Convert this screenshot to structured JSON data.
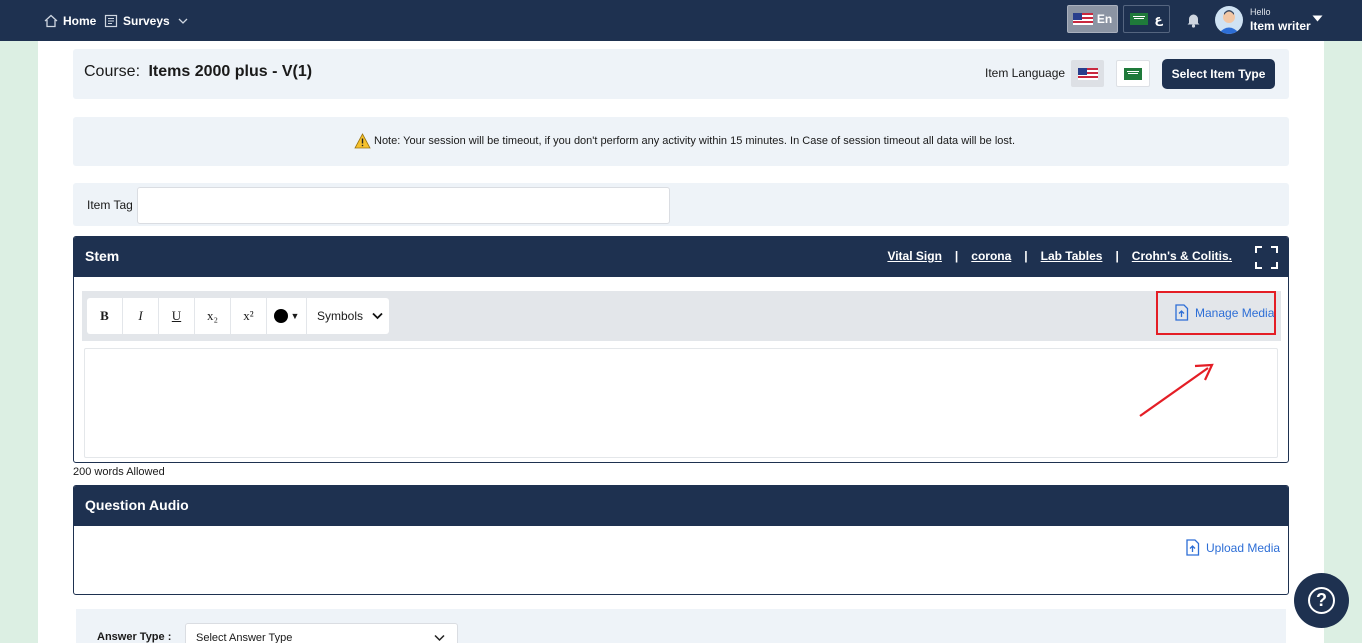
{
  "nav": {
    "home": "Home",
    "surveys": "Surveys",
    "lang_en": "En",
    "lang_ar": "ع",
    "greeting": "Hello",
    "user_name": "Item writer"
  },
  "course": {
    "label": "Course:",
    "name": "Items 2000 plus - V(1)",
    "item_language_label": "Item Language",
    "select_item_type": "Select Item Type"
  },
  "note": {
    "text": "Note: Your session will be timeout, if you don't perform any activity within 15 minutes. In Case of session timeout all data will be lost."
  },
  "item_tag": {
    "label": "Item Tag",
    "value": ""
  },
  "stem": {
    "title": "Stem",
    "links": [
      "Vital Sign",
      "corona",
      "Lab Tables",
      "Crohn's & Colitis."
    ],
    "separator": "|",
    "toolbar": {
      "bold": "B",
      "italic": "I",
      "underline": "U",
      "subscript": "x₂",
      "superscript": "x²",
      "color_caret": "▼",
      "symbols": "Symbols"
    },
    "manage_media": "Manage Media",
    "word_limit": "200 words Allowed"
  },
  "question_audio": {
    "title": "Question Audio",
    "upload_media": "Upload Media"
  },
  "answer_type": {
    "label": "Answer Type :",
    "placeholder": "Select Answer Type"
  },
  "colors": {
    "navy": "#1e3150",
    "highlight": "#e41e26",
    "link": "#2d6ed6"
  }
}
